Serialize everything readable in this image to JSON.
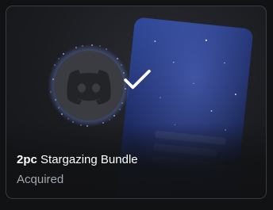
{
  "item": {
    "quantity": "2pc",
    "name": "Stargazing Bundle",
    "status": "Acquired",
    "owned": true
  },
  "colors": {
    "page_background": "#111214",
    "card_border": "#3a3b40",
    "title": "#ffffff",
    "status": "#a3a6ad",
    "check": "#ffffff",
    "avatar": "#3b3c41",
    "logo": "#232428",
    "panel_space": "#2a3a78",
    "sparkle": "#6f8fe6"
  },
  "icons": {
    "logo": "discord-logo-icon",
    "owned": "checkmark-icon"
  }
}
